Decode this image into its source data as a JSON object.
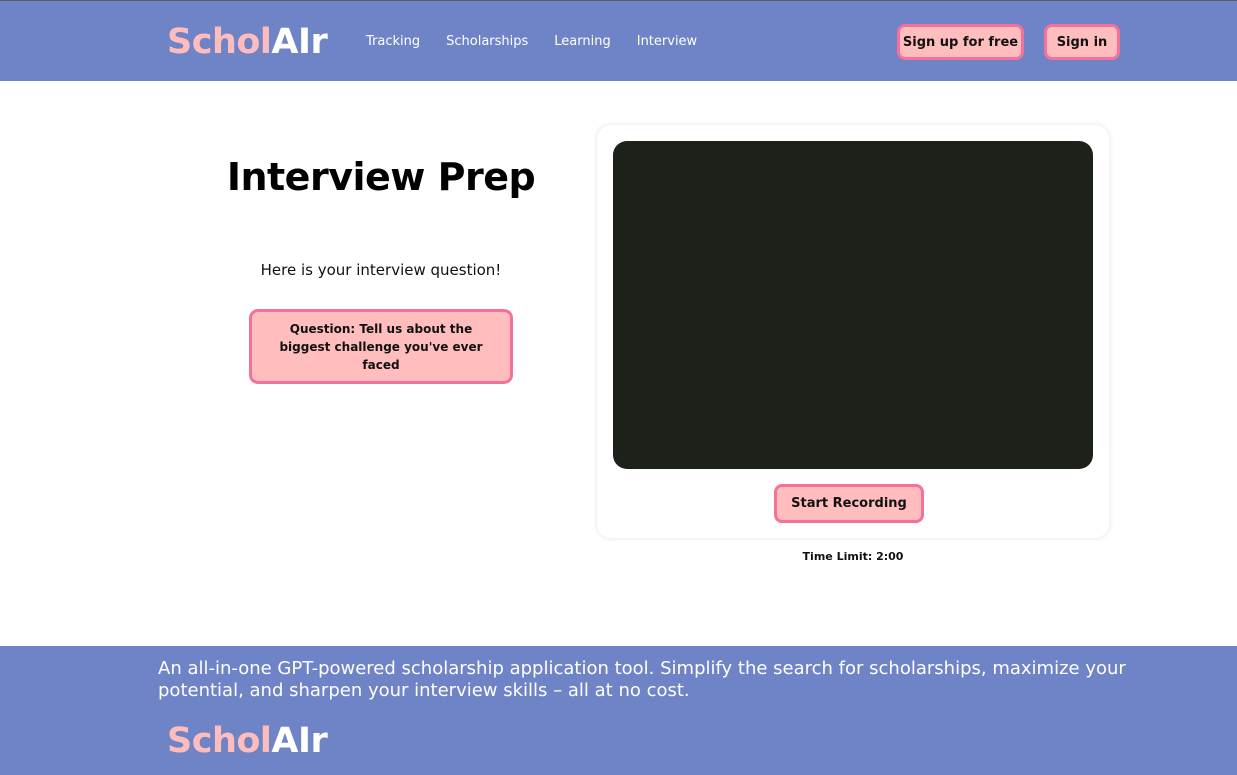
{
  "brand": {
    "logo_part1": "Schol",
    "logo_part2": "AIr"
  },
  "nav": {
    "items": [
      "Tracking",
      "Scholarships",
      "Learning",
      "Interview"
    ]
  },
  "auth": {
    "signup_label": "Sign up for free",
    "signin_label": "Sign in"
  },
  "main": {
    "title": "Interview Prep",
    "subtitle": "Here is your interview question!",
    "question": "Question: Tell us about the biggest challenge you've ever faced",
    "record_label": "Start Recording",
    "time_limit": "Time Limit: 2:00"
  },
  "footer": {
    "tagline": "An all-in-one GPT-powered scholarship application tool. Simplify the search for scholarships, maximize your potential, and sharpen your interview skills – all at no cost."
  },
  "colors": {
    "header_bg": "#6f84c7",
    "button_bg": "#ffbdbd",
    "button_border": "#f4719c",
    "video_bg": "#1c2119"
  }
}
